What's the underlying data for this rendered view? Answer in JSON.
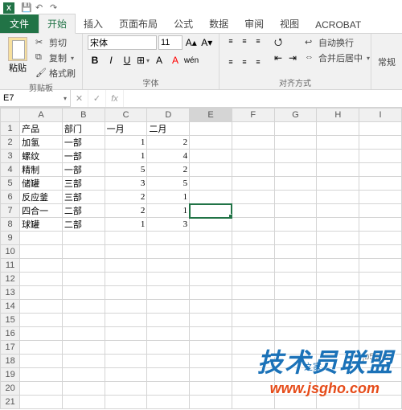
{
  "qat": {
    "save": "💾"
  },
  "tabs": {
    "file": "文件",
    "items": [
      "开始",
      "插入",
      "页面布局",
      "公式",
      "数据",
      "审阅",
      "视图",
      "ACROBAT"
    ],
    "active": 0
  },
  "ribbon": {
    "clipboard": {
      "paste": "粘贴",
      "cut": "剪切",
      "copy": "复制",
      "format_painter": "格式刷",
      "label": "剪贴板"
    },
    "font": {
      "name": "宋体",
      "size": "11",
      "label": "字体",
      "bold": "B",
      "italic": "I",
      "underline": "U"
    },
    "alignment": {
      "wrap": "自动换行",
      "merge": "合并后居中",
      "label": "对齐方式"
    },
    "number": {
      "general": "常规"
    }
  },
  "namebox": "E7",
  "formula": "",
  "columns": [
    "A",
    "B",
    "C",
    "D",
    "E",
    "F",
    "G",
    "H",
    "I"
  ],
  "rows": [
    {
      "n": 1,
      "c": [
        "产品",
        "部门",
        "一月",
        "二月",
        "",
        "",
        "",
        "",
        ""
      ]
    },
    {
      "n": 2,
      "c": [
        "加氢",
        "一部",
        "1",
        "2",
        "",
        "",
        "",
        "",
        ""
      ]
    },
    {
      "n": 3,
      "c": [
        "螺纹",
        "一部",
        "1",
        "4",
        "",
        "",
        "",
        "",
        ""
      ]
    },
    {
      "n": 4,
      "c": [
        "精制",
        "一部",
        "5",
        "2",
        "",
        "",
        "",
        "",
        ""
      ]
    },
    {
      "n": 5,
      "c": [
        "储罐",
        "三部",
        "3",
        "5",
        "",
        "",
        "",
        "",
        ""
      ]
    },
    {
      "n": 6,
      "c": [
        "反应釜",
        "三部",
        "2",
        "1",
        "",
        "",
        "",
        "",
        ""
      ]
    },
    {
      "n": 7,
      "c": [
        "四合一",
        "二部",
        "2",
        "1",
        "",
        "",
        "",
        "",
        ""
      ]
    },
    {
      "n": 8,
      "c": [
        "球罐",
        "二部",
        "1",
        "3",
        "",
        "",
        "",
        "",
        ""
      ]
    },
    {
      "n": 9,
      "c": [
        "",
        "",
        "",
        "",
        "",
        "",
        "",
        "",
        ""
      ]
    },
    {
      "n": 10,
      "c": [
        "",
        "",
        "",
        "",
        "",
        "",
        "",
        "",
        ""
      ]
    },
    {
      "n": 11,
      "c": [
        "",
        "",
        "",
        "",
        "",
        "",
        "",
        "",
        ""
      ]
    },
    {
      "n": 12,
      "c": [
        "",
        "",
        "",
        "",
        "",
        "",
        "",
        "",
        ""
      ]
    },
    {
      "n": 13,
      "c": [
        "",
        "",
        "",
        "",
        "",
        "",
        "",
        "",
        ""
      ]
    },
    {
      "n": 14,
      "c": [
        "",
        "",
        "",
        "",
        "",
        "",
        "",
        "",
        ""
      ]
    },
    {
      "n": 15,
      "c": [
        "",
        "",
        "",
        "",
        "",
        "",
        "",
        "",
        ""
      ]
    },
    {
      "n": 16,
      "c": [
        "",
        "",
        "",
        "",
        "",
        "",
        "",
        "",
        ""
      ]
    },
    {
      "n": 17,
      "c": [
        "",
        "",
        "",
        "",
        "",
        "",
        "",
        "",
        ""
      ]
    },
    {
      "n": 18,
      "c": [
        "",
        "",
        "",
        "",
        "",
        "",
        "",
        "",
        ""
      ]
    },
    {
      "n": 19,
      "c": [
        "",
        "",
        "",
        "",
        "",
        "",
        "",
        "",
        ""
      ]
    },
    {
      "n": 20,
      "c": [
        "",
        "",
        "",
        "",
        "",
        "",
        "",
        "",
        ""
      ]
    },
    {
      "n": 21,
      "c": [
        "",
        "",
        "",
        "",
        "",
        "",
        "",
        "",
        ""
      ]
    }
  ],
  "selection": {
    "row": 7,
    "col": 4
  },
  "numeric_cols": [
    2,
    3
  ],
  "watermark": {
    "line1": "技术员联盟",
    "line2": "www.jsgho.com",
    "line3": "jb51.net",
    "line4": "之家"
  }
}
